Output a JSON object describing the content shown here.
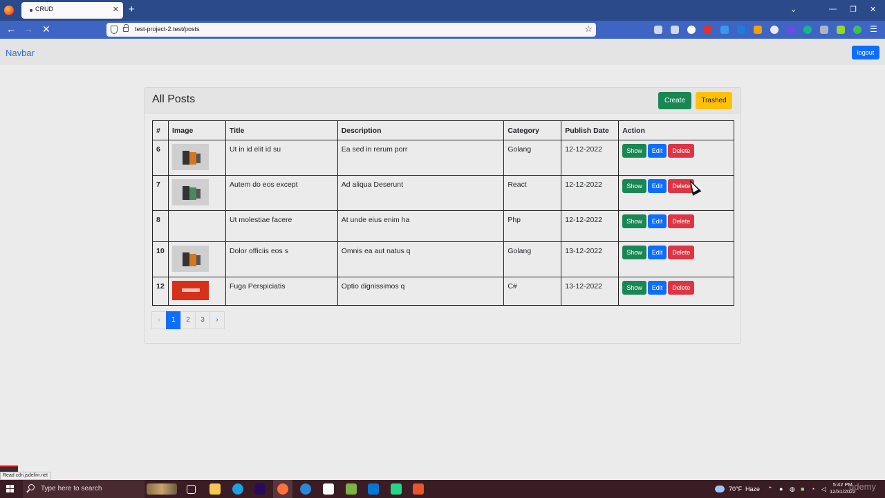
{
  "browser": {
    "tab_title": "CRUD",
    "url": "test-project-2.test/posts",
    "status_text": "Read cdn.jsdelivr.net"
  },
  "navbar": {
    "brand": "Navbar",
    "logout_label": "logout"
  },
  "card": {
    "title": "All Posts",
    "create_label": "Create",
    "trashed_label": "Trashed"
  },
  "table": {
    "headers": [
      "#",
      "Image",
      "Title",
      "Description",
      "Category",
      "Publish Date",
      "Action"
    ],
    "rows": [
      {
        "id": "6",
        "title": "Ut in id elit id su",
        "description": "Ea sed in rerum porr",
        "category": "Golang",
        "date": "12-12-2022"
      },
      {
        "id": "7",
        "title": "Autem do eos except",
        "description": "Ad aliqua Deserunt",
        "category": "React",
        "date": "12-12-2022"
      },
      {
        "id": "8",
        "title": "Ut molestiae facere",
        "description": "At unde eius enim ha",
        "category": "Php",
        "date": "12-12-2022"
      },
      {
        "id": "10",
        "title": "Dolor officiis eos s",
        "description": "Omnis ea aut natus q",
        "category": "Golang",
        "date": "13-12-2022"
      },
      {
        "id": "12",
        "title": "Fuga Perspiciatis",
        "description": "Optio dignissimos q",
        "category": "C#",
        "date": "13-12-2022"
      }
    ],
    "actions": {
      "show": "Show",
      "edit": "Edit",
      "delete": "Delete"
    }
  },
  "pagination": {
    "prev": "‹",
    "pages": [
      "1",
      "2",
      "3"
    ],
    "next": "›",
    "current": "1"
  },
  "taskbar": {
    "search_placeholder": "Type here to search",
    "weather_temp": "70°F",
    "weather_text": "Haze",
    "time": "5:42 PM",
    "date": "12/31/2022"
  },
  "colors": {
    "primary": "#0d6efd",
    "success": "#198754",
    "warning": "#ffc107",
    "danger": "#dc3545"
  }
}
